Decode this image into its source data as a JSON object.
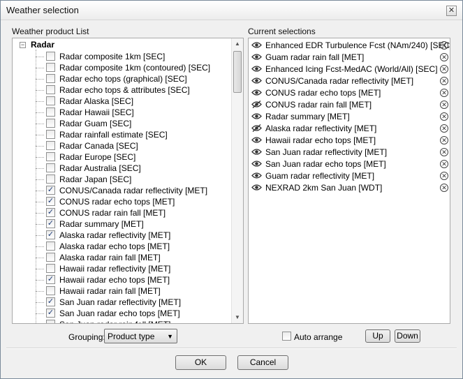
{
  "window": {
    "title": "Weather selection"
  },
  "left": {
    "label": "Weather product List",
    "root": "Radar",
    "items": [
      {
        "label": "Radar composite 1km [SEC]",
        "checked": false
      },
      {
        "label": "Radar composite 1km (contoured) [SEC]",
        "checked": false
      },
      {
        "label": "Radar echo tops (graphical) [SEC]",
        "checked": false
      },
      {
        "label": "Radar echo tops & attributes [SEC]",
        "checked": false
      },
      {
        "label": "Radar Alaska [SEC]",
        "checked": false
      },
      {
        "label": "Radar Hawaii [SEC]",
        "checked": false
      },
      {
        "label": "Radar Guam [SEC]",
        "checked": false
      },
      {
        "label": "Radar rainfall estimate [SEC]",
        "checked": false
      },
      {
        "label": "Radar Canada [SEC]",
        "checked": false
      },
      {
        "label": "Radar Europe [SEC]",
        "checked": false
      },
      {
        "label": "Radar Australia [SEC]",
        "checked": false
      },
      {
        "label": "Radar Japan [SEC]",
        "checked": false
      },
      {
        "label": "CONUS/Canada radar reflectivity [MET]",
        "checked": true
      },
      {
        "label": "CONUS radar echo tops [MET]",
        "checked": true
      },
      {
        "label": "CONUS radar rain fall [MET]",
        "checked": true
      },
      {
        "label": "Radar summary [MET]",
        "checked": true
      },
      {
        "label": "Alaska radar reflectivity [MET]",
        "checked": true
      },
      {
        "label": "Alaska radar echo tops [MET]",
        "checked": false
      },
      {
        "label": "Alaska radar rain fall [MET]",
        "checked": false
      },
      {
        "label": "Hawaii radar reflectivity [MET]",
        "checked": false
      },
      {
        "label": "Hawaii radar echo tops [MET]",
        "checked": true
      },
      {
        "label": "Hawaii radar rain fall [MET]",
        "checked": false
      },
      {
        "label": "San Juan radar reflectivity [MET]",
        "checked": true
      },
      {
        "label": "San Juan radar echo tops [MET]",
        "checked": true
      },
      {
        "label": "San Juan radar rain fall [MET]",
        "checked": false
      }
    ]
  },
  "right": {
    "label": "Current selections",
    "items": [
      {
        "label": "Enhanced EDR Turbulence Fcst (NAm/240) [SEC]",
        "visible": true
      },
      {
        "label": "Guam radar rain fall [MET]",
        "visible": true
      },
      {
        "label": "Enhanced Icing Fcst-MedAC (World/All) [SEC]",
        "visible": true
      },
      {
        "label": "CONUS/Canada radar reflectivity [MET]",
        "visible": true
      },
      {
        "label": "CONUS radar echo tops [MET]",
        "visible": true
      },
      {
        "label": "CONUS radar rain fall [MET]",
        "visible": false
      },
      {
        "label": "Radar summary [MET]",
        "visible": true
      },
      {
        "label": "Alaska radar reflectivity [MET]",
        "visible": false
      },
      {
        "label": "Hawaii radar echo tops [MET]",
        "visible": true
      },
      {
        "label": "San Juan radar reflectivity [MET]",
        "visible": true
      },
      {
        "label": "San Juan radar echo tops [MET]",
        "visible": true
      },
      {
        "label": "Guam radar reflectivity [MET]",
        "visible": true
      },
      {
        "label": "NEXRAD 2km San Juan [WDT]",
        "visible": true
      }
    ]
  },
  "controls": {
    "grouping_label": "Grouping:",
    "grouping_value": "Product type",
    "auto_arrange_label": "Auto arrange",
    "auto_arrange_checked": false,
    "up_label": "Up",
    "down_label": "Down",
    "ok_label": "OK",
    "cancel_label": "Cancel"
  }
}
